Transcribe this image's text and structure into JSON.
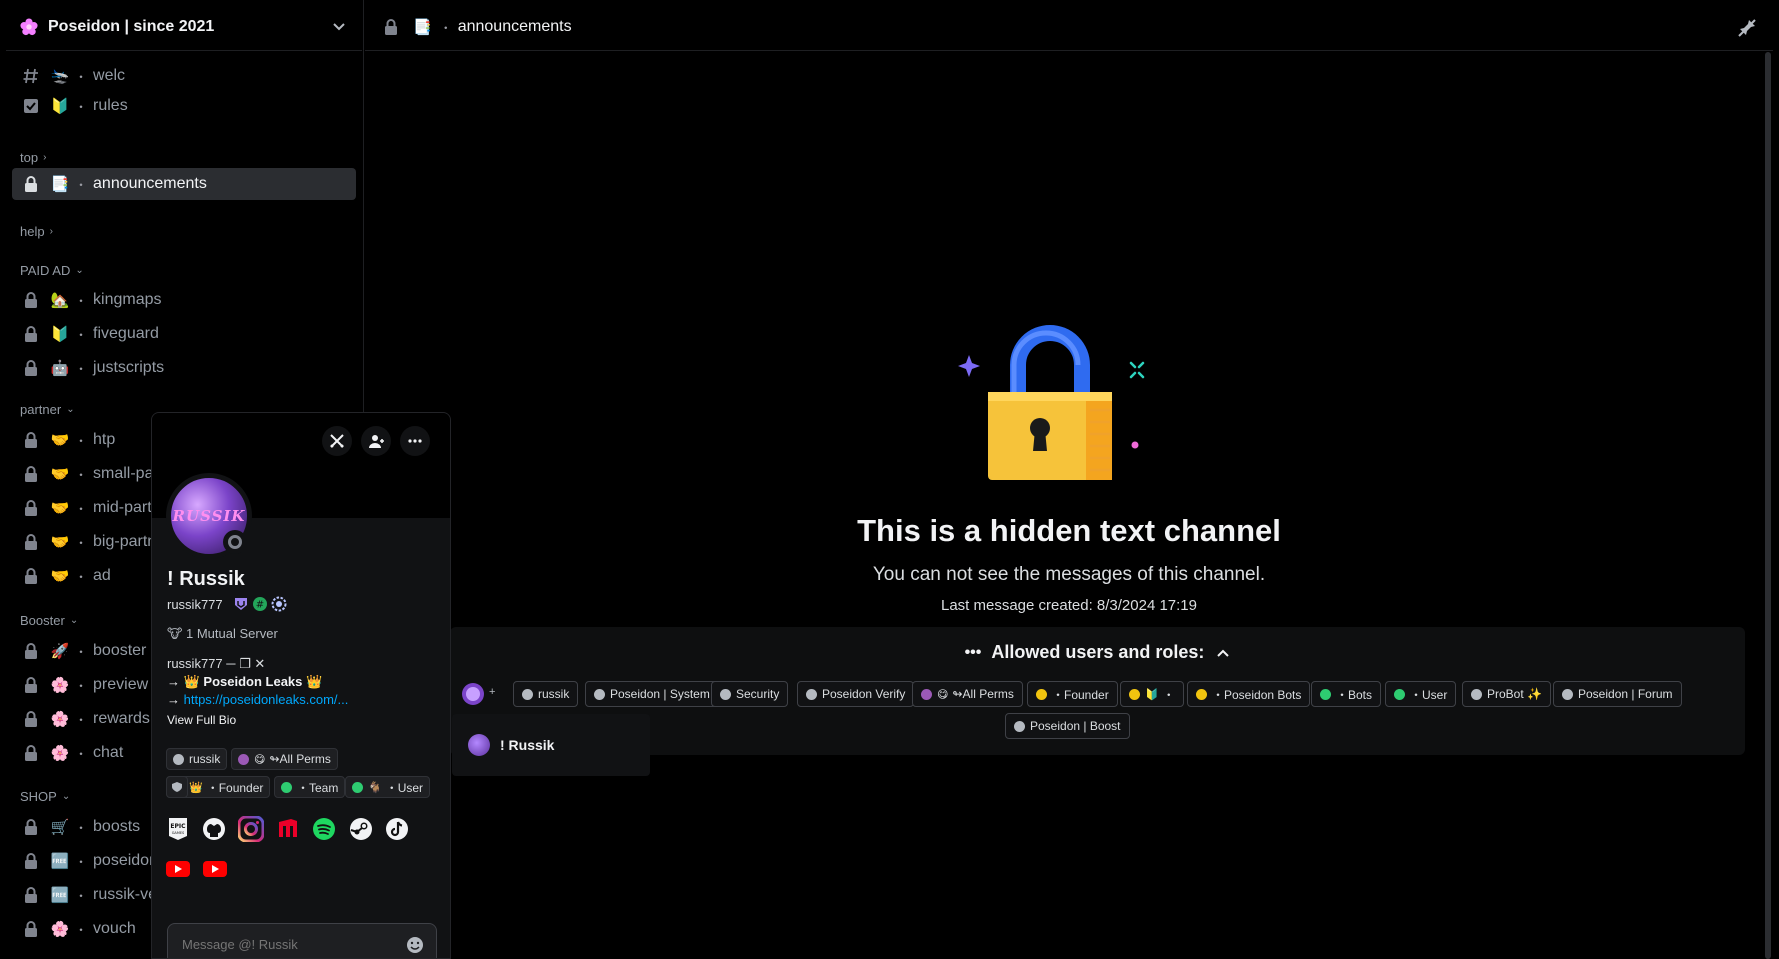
{
  "server": {
    "name": "Poseidon | since 2021",
    "icon": "flower-icon"
  },
  "sidebar": {
    "channels_top": [
      {
        "icon": "hash-icon",
        "emoji": "🛬",
        "name": "welc"
      },
      {
        "icon": "rules-icon",
        "emoji": "🔰",
        "name": "rules"
      }
    ],
    "categories": {
      "top": "top",
      "help": "help",
      "paid_ad": "PAID AD",
      "partner": "partner",
      "booster": "Booster",
      "shop": "SHOP"
    },
    "active_channel": {
      "emoji": "📑",
      "name": "announcements"
    },
    "paid_ad": [
      {
        "emoji": "🏡",
        "name": "kingmaps"
      },
      {
        "emoji": "🔰",
        "name": "fiveguard"
      },
      {
        "emoji": "🤖",
        "name": "justscripts"
      }
    ],
    "partner": [
      {
        "emoji": "🤝",
        "name": "htp"
      },
      {
        "emoji": "🤝",
        "name": "small-par"
      },
      {
        "emoji": "🤝",
        "name": "mid-partr"
      },
      {
        "emoji": "🤝",
        "name": "big-partn"
      },
      {
        "emoji": "🤝",
        "name": "ad"
      }
    ],
    "booster": [
      {
        "emoji": "🚀",
        "name": "booster"
      },
      {
        "emoji": "🌸",
        "name": "preview"
      },
      {
        "emoji": "🌸",
        "name": "rewards"
      },
      {
        "emoji": "🌸",
        "name": "chat"
      }
    ],
    "shop": [
      {
        "emoji": "🛒",
        "name": "boosts"
      },
      {
        "emoji": "🆓",
        "name": "poseidon-"
      },
      {
        "emoji": "🆓",
        "name": "russik-ve"
      },
      {
        "emoji": "🌸",
        "name": "vouch"
      }
    ]
  },
  "header": {
    "channel_emoji": "📑",
    "channel_name": "announcements"
  },
  "hidden_channel": {
    "title": "This is a hidden text channel",
    "subtitle": "You can not see the messages of this channel.",
    "last_message": "Last message created: 8/3/2024 17:19",
    "allowed_heading": "Allowed users and roles:",
    "roles": [
      {
        "name": "russik",
        "color": "#b5bac1",
        "emoji": ""
      },
      {
        "name": "Poseidon | System",
        "color": "#b5bac1",
        "emoji": ""
      },
      {
        "name": "Security",
        "color": "#b5bac1",
        "emoji": ""
      },
      {
        "name": "Poseidon Verify",
        "color": "#b5bac1",
        "emoji": ""
      },
      {
        "name": "↬All Perms",
        "color": "#9b59b6",
        "emoji": "😋"
      },
      {
        "name": "・Founder",
        "color": "#f1c40f",
        "emoji": ""
      },
      {
        "name": "・",
        "color": "#f1c40f",
        "emoji": "🔰"
      },
      {
        "name": "・Poseidon Bots",
        "color": "#f1c40f",
        "emoji": ""
      },
      {
        "name": "・Bots",
        "color": "#2ecc71",
        "emoji": ""
      },
      {
        "name": "・User",
        "color": "#2ecc71",
        "emoji": ""
      },
      {
        "name": "ProBot ✨",
        "color": "#b5bac1",
        "emoji": ""
      },
      {
        "name": "Poseidon | Forum",
        "color": "#b5bac1",
        "emoji": ""
      },
      {
        "name": "Poseidon | Boost",
        "color": "#b5bac1",
        "emoji": ""
      }
    ],
    "avatar_more": "+",
    "tooltip_user": "! Russik"
  },
  "profile": {
    "avatar_text": "RUSSIK",
    "display_name": "! Russik",
    "username": "russik777",
    "mutual": "1 Mutual Server",
    "mutual_emoji": "🐮",
    "bio_line1": "russik777 ─  ❐  ✕",
    "bio_line2": "→ 👑 Poseidon Leaks 👑",
    "bio_line3_arrow": "→",
    "bio_link": "https://poseidonleaks.com/...",
    "view_full_bio": "View Full Bio",
    "roles": [
      {
        "name": "russik",
        "color": "#b5bac1",
        "emoji": ""
      },
      {
        "name": "↬All Perms",
        "color": "#9b59b6",
        "emoji": "😋"
      },
      {
        "name": "・Founder",
        "color": "#f1c40f",
        "emoji": "👑"
      },
      {
        "name": "・Team",
        "color": "#2ecc71",
        "emoji": ""
      },
      {
        "name": "・User",
        "color": "#2ecc71",
        "emoji": "🐐"
      }
    ],
    "connections": [
      "epic-games-icon",
      "github-icon",
      "instagram-icon",
      "riot-games-icon",
      "spotify-icon",
      "steam-icon",
      "tiktok-icon",
      "youtube-icon",
      "youtube-icon"
    ],
    "message_placeholder": "Message @! Russik"
  },
  "colors": {
    "background": "#000000",
    "panel": "#111214",
    "active": "#2b2d31",
    "link": "#00a8fc",
    "lock_gold": "#f6c33a",
    "lock_blue": "#4a7bf0"
  }
}
